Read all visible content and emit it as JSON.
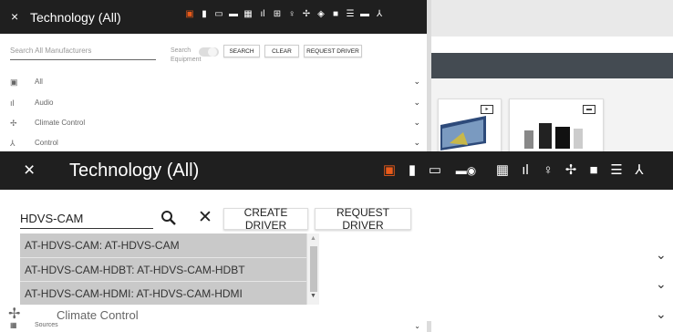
{
  "background": {
    "header": {
      "close": "×",
      "title": "Technology (All)"
    },
    "icons": [
      "processor-icon",
      "projector-icon",
      "display-icon",
      "receiver-icon",
      "film-icon",
      "audio-icon",
      "grid-icon",
      "bulb-icon",
      "fan-icon",
      "shield-icon",
      "camera-icon",
      "list-icon",
      "disc-icon",
      "network-icon"
    ],
    "search_placeholder": "Search All Manufacturers",
    "search_equipment": "Search Equipment",
    "buttons": {
      "search": "SEARCH",
      "clear": "CLEAR",
      "request": "REQUEST DRIVER"
    },
    "categories": [
      {
        "label": "All",
        "icon": "grid-icon"
      },
      {
        "label": "Audio",
        "icon": "audio-icon"
      },
      {
        "label": "Climate Control",
        "icon": "fan-icon"
      },
      {
        "label": "Control",
        "icon": "network-icon"
      }
    ],
    "sources_label": "Sources"
  },
  "dialog": {
    "close": "×",
    "title": "Technology (All)",
    "search_value": "HDVS-CAM",
    "buttons": {
      "create": "CREATE DRIVER",
      "request": "REQUEST DRIVER"
    },
    "suggestions": [
      "AT-HDVS-CAM: AT-HDVS-CAM",
      "AT-HDVS-CAM-HDBT: AT-HDVS-CAM-HDBT",
      "AT-HDVS-CAM-HDMI: AT-HDVS-CAM-HDMI"
    ],
    "climate_label": "Climate Control"
  },
  "colors": {
    "header_bg": "#1f1f1f",
    "accent": "#e85a1a",
    "suggestion_bg": "#c9c9c9"
  }
}
